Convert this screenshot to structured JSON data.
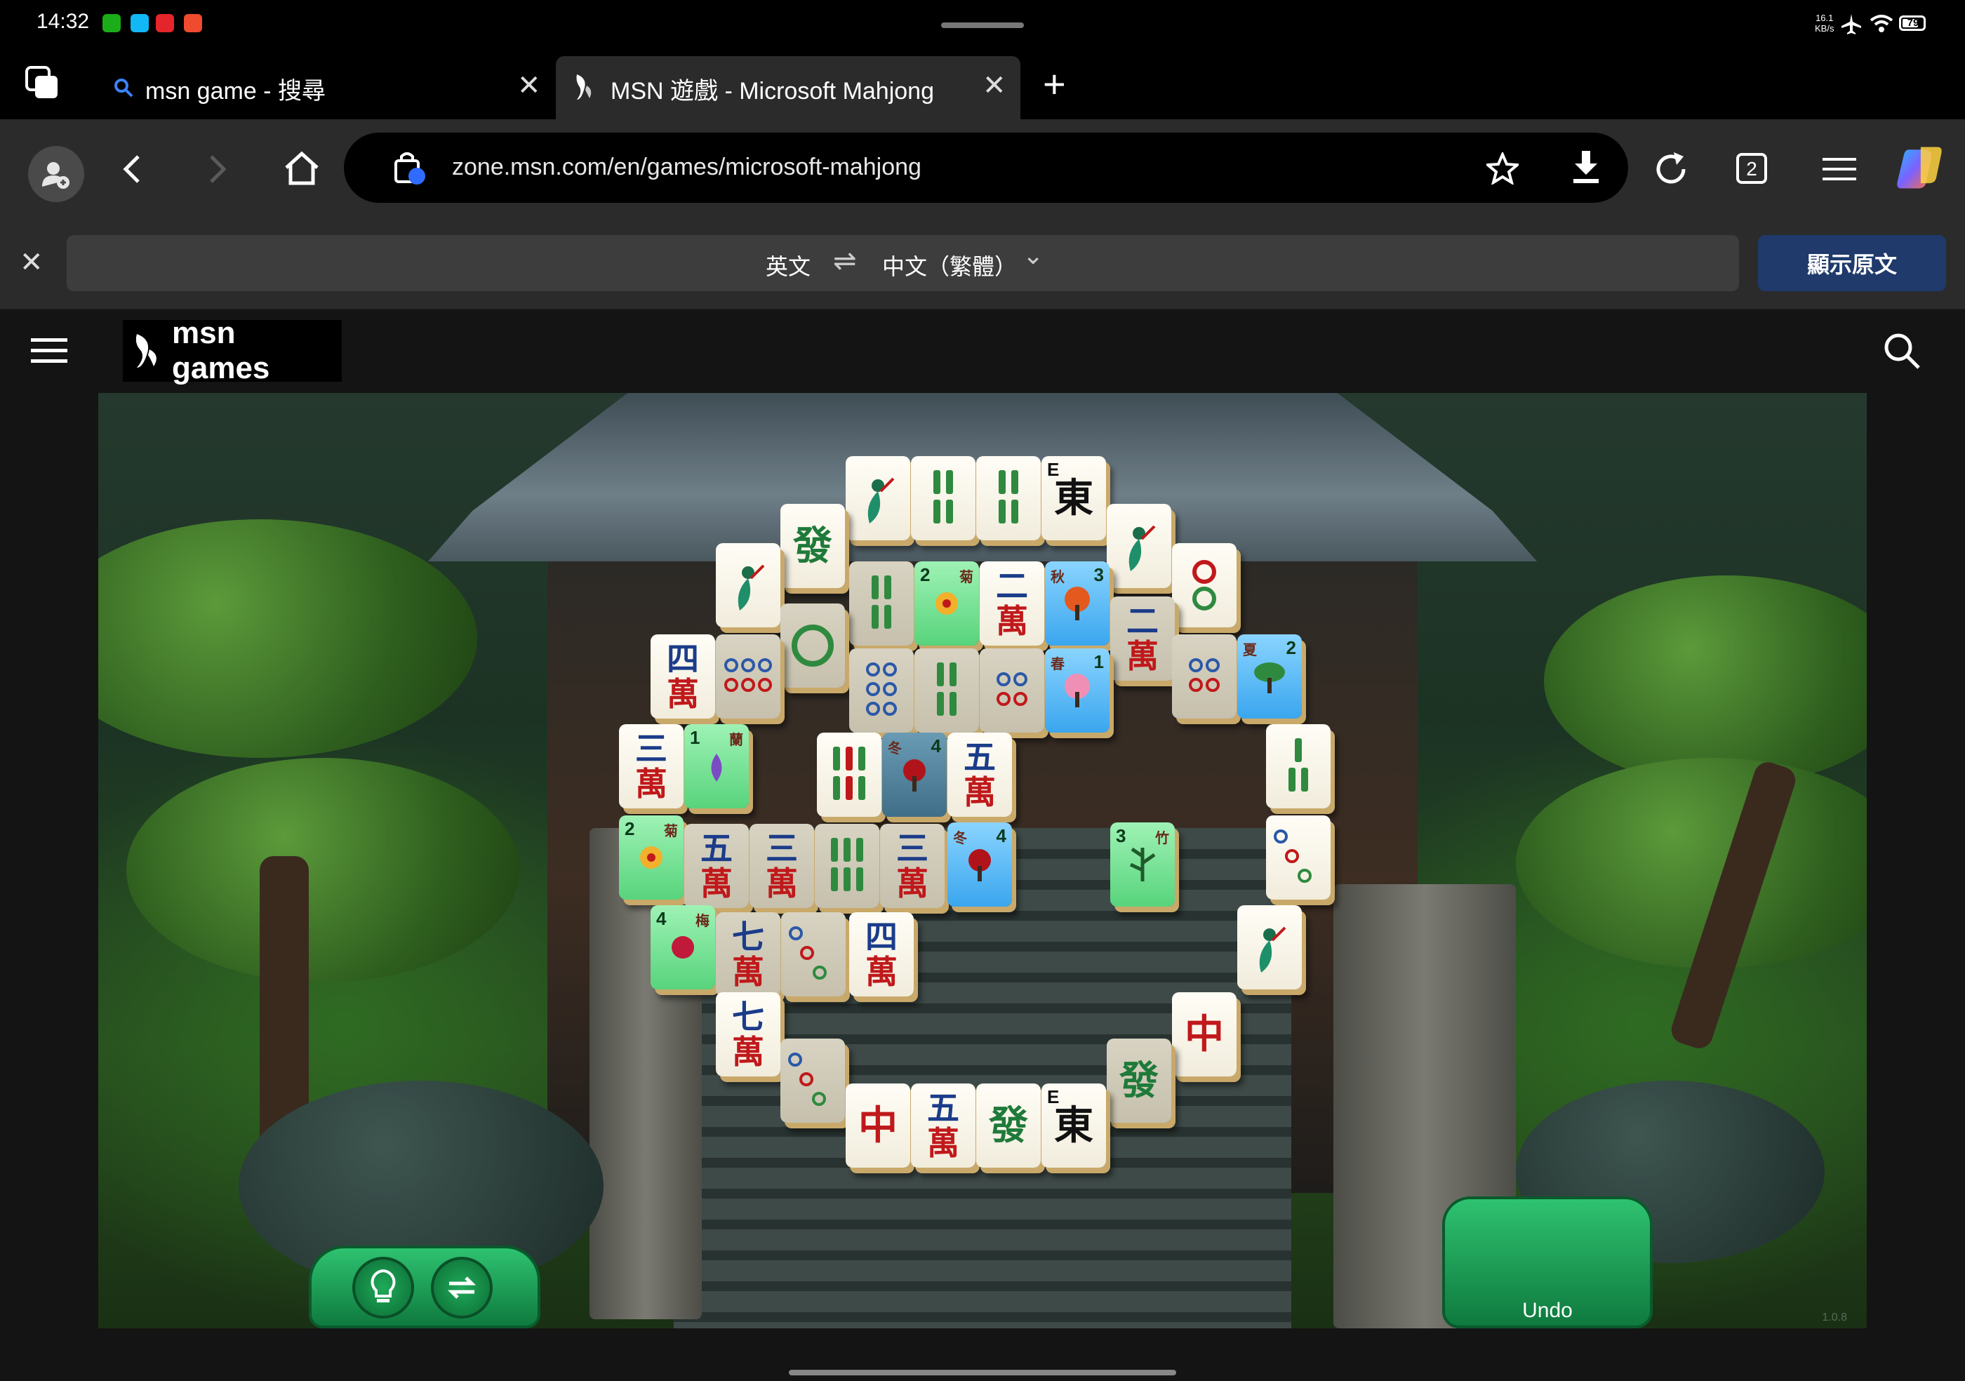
{
  "status_bar": {
    "time": "14:32",
    "net_speed_value": "16.1",
    "net_speed_unit": "KB/s",
    "battery": "79",
    "battery_fraction": 0.79
  },
  "tabs": [
    {
      "title": "msn game - 搜尋",
      "close": "✕"
    },
    {
      "title": "MSN 遊戲 - Microsoft Mahjong",
      "close": "✕"
    }
  ],
  "new_tab": "+",
  "address_bar": {
    "url": "zone.msn.com/en/games/microsoft-mahjong",
    "tab_count": "2"
  },
  "translate_bar": {
    "source_lang": "英文",
    "swap": "⇌",
    "target_lang": "中文（繁體）",
    "chevron": "⌄",
    "show_original": "顯示原文",
    "close": "✕"
  },
  "msn": {
    "brand": "msn games"
  },
  "game": {
    "undo_label": "Undo",
    "version": "1.0.8",
    "tiles": {
      "east": "東",
      "north_label": "E",
      "green_dragon": "發",
      "red_dragon": "中",
      "wan": "萬",
      "one": "一",
      "two": "二",
      "three": "三",
      "four": "四",
      "five": "五",
      "seven": "七",
      "ju": "菊",
      "qiu": "秋",
      "chun": "春",
      "xia": "夏",
      "dong": "冬",
      "lan": "蘭",
      "zhu": "竹",
      "mei": "梅",
      "n1": "1",
      "n2": "2",
      "n3": "3",
      "n4": "4"
    }
  },
  "colors": {
    "accent_blue": "#1f3a6b",
    "game_green": "#1faa5a",
    "copilot": "#7b61ff"
  }
}
